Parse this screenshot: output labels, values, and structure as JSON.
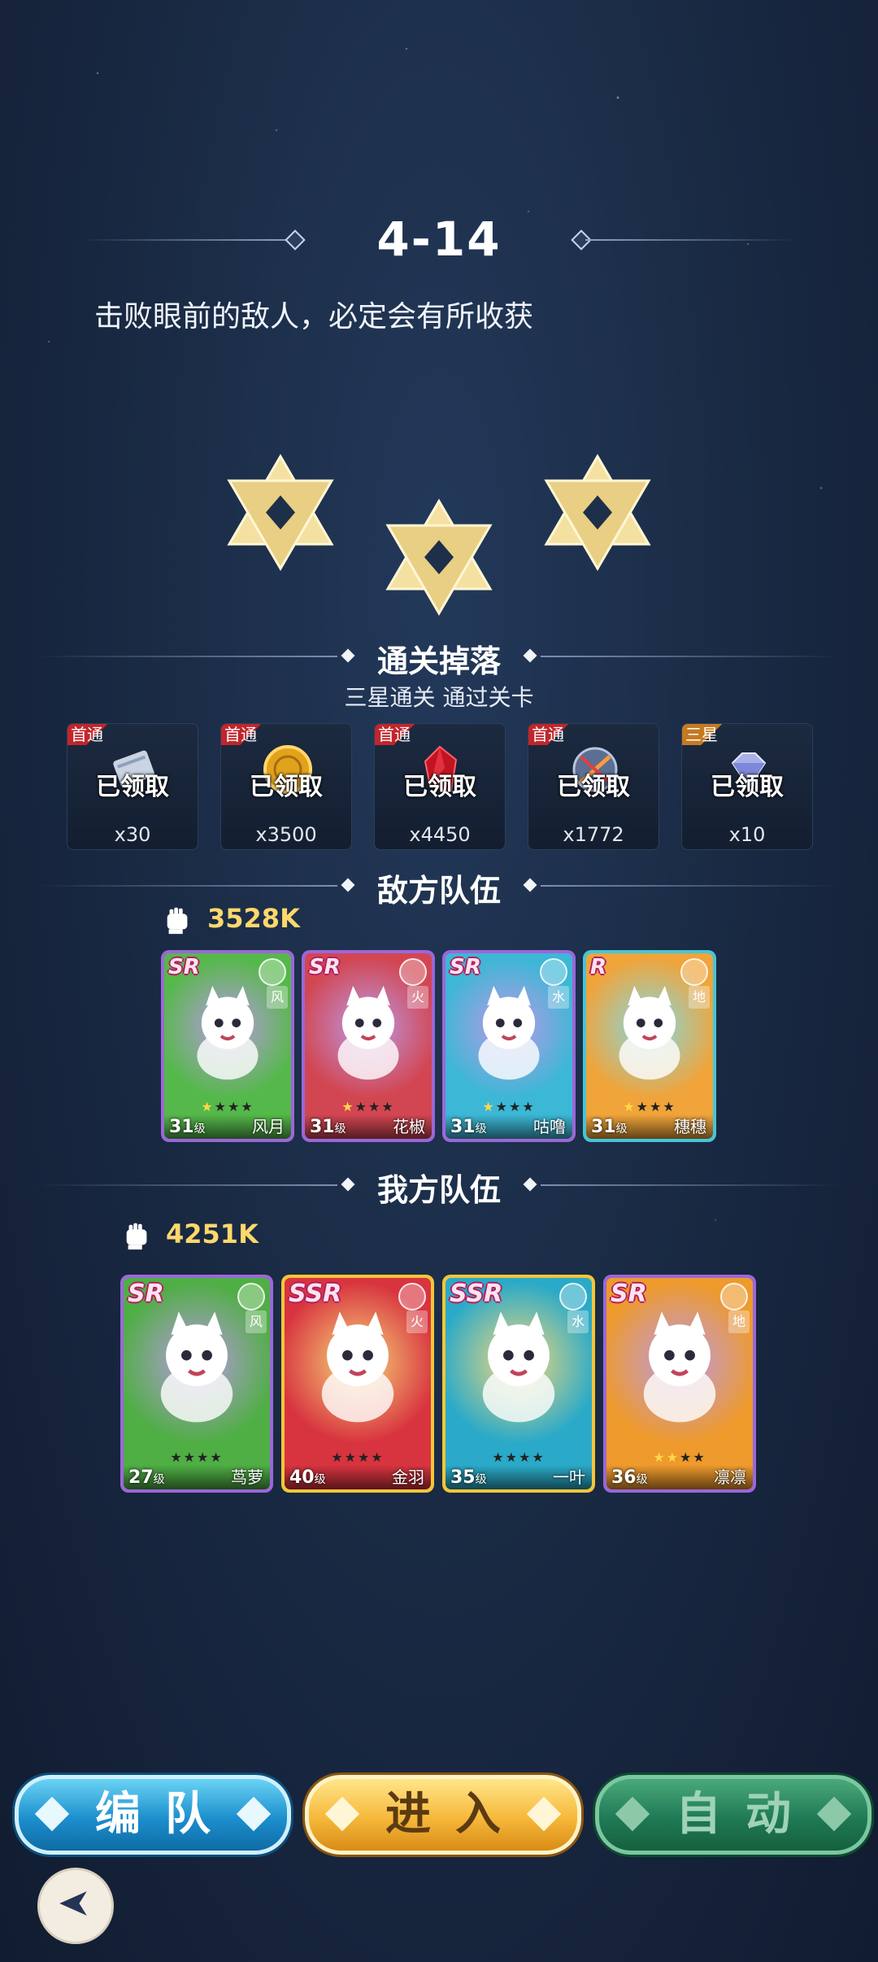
{
  "stage": {
    "title": "4-14",
    "subtitle": "击败眼前的敌人，必定会有所收获",
    "stars_earned": 3,
    "stars_total": 3
  },
  "rewards_section": {
    "title": "通关掉落",
    "subtitle": "三星通关  通过关卡",
    "items": [
      {
        "tag": "首通",
        "status": "已领取",
        "qty": "x30",
        "icon": "scroll-icon"
      },
      {
        "tag": "首通",
        "status": "已领取",
        "qty": "x3500",
        "icon": "gold-coin-icon"
      },
      {
        "tag": "首通",
        "status": "已领取",
        "qty": "x4450",
        "icon": "red-crystal-icon"
      },
      {
        "tag": "首通",
        "status": "已领取",
        "qty": "x1772",
        "icon": "orb-icon"
      },
      {
        "tag": "三星",
        "status": "已领取",
        "qty": "x10",
        "icon": "diamond-icon"
      }
    ]
  },
  "enemy_team": {
    "title": "敌方队伍",
    "power": "3528K",
    "members": [
      {
        "rarity": "SR",
        "element": "风",
        "level": "31",
        "level_unit": "级",
        "name": "风月",
        "stars": 1,
        "max_stars": 4,
        "theme": "#55b84a"
      },
      {
        "rarity": "SR",
        "element": "火",
        "level": "31",
        "level_unit": "级",
        "name": "花椒",
        "stars": 1,
        "max_stars": 4,
        "theme": "#d24652"
      },
      {
        "rarity": "SR",
        "element": "水",
        "level": "31",
        "level_unit": "级",
        "name": "咕噜",
        "stars": 1,
        "max_stars": 4,
        "theme": "#3cb7d6"
      },
      {
        "rarity": "R",
        "element": "地",
        "level": "31",
        "level_unit": "级",
        "name": "穗穗",
        "stars": 1,
        "max_stars": 4,
        "theme": "#f0a43a"
      }
    ]
  },
  "ally_team": {
    "title": "我方队伍",
    "power": "4251K",
    "members": [
      {
        "rarity": "SR",
        "element": "风",
        "level": "27",
        "level_unit": "级",
        "name": "茑萝",
        "stars": 0,
        "max_stars": 4,
        "theme": "#4fae44"
      },
      {
        "rarity": "SSR",
        "element": "火",
        "level": "40",
        "level_unit": "级",
        "name": "金羽",
        "stars": 0,
        "max_stars": 4,
        "theme": "#d8343f"
      },
      {
        "rarity": "SSR",
        "element": "水",
        "level": "35",
        "level_unit": "级",
        "name": "一叶",
        "stars": 0,
        "max_stars": 4,
        "theme": "#2aaac8"
      },
      {
        "rarity": "SR",
        "element": "地",
        "level": "36",
        "level_unit": "级",
        "name": "凛凛",
        "stars": 2,
        "max_stars": 4,
        "theme": "#ee9a2c"
      }
    ]
  },
  "buttons": {
    "team": "编队",
    "enter": "进入",
    "auto": "自动"
  },
  "colors": {
    "star_gold": "#f6e4a8",
    "power_gold": "#ffd86b",
    "sr_border": "#9b67d8",
    "ssr_border": "#f3c638",
    "r_border": "#46c6d6"
  }
}
